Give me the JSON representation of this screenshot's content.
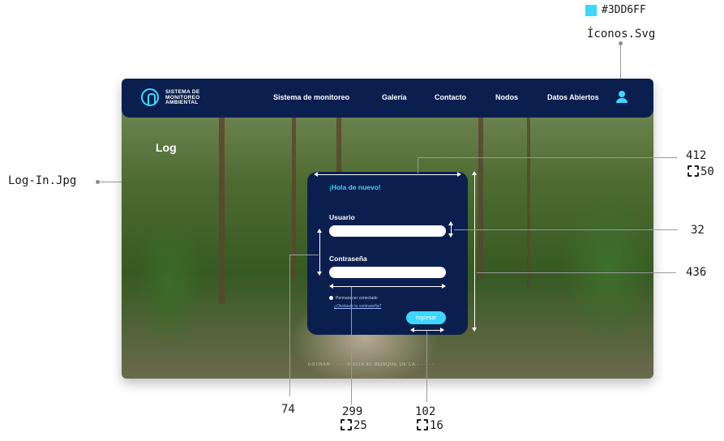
{
  "annotations": {
    "color_swatch": {
      "hex": "#3DD6FF",
      "label": "#3DD6FF"
    },
    "icons_file": "Íconos.Svg",
    "bg_file": "Log-In.Jpg",
    "dims": {
      "card_width": "412",
      "card_radius": "50",
      "input_height": "32",
      "card_height": "436",
      "label_spacing": "74",
      "input_width": "299",
      "input_radius": "25",
      "button_width": "102",
      "button_radius": "16"
    }
  },
  "navbar": {
    "logo_lines": [
      "SISTEMA DE",
      "MONITOREO",
      "AMBIENTAL"
    ],
    "items": [
      "Sistema de monitoreo",
      "Galería",
      "Contacto",
      "Nodos",
      "Datos Abiertos"
    ]
  },
  "page": {
    "title": "Log"
  },
  "login": {
    "greeting": "¡Hola de nuevo!",
    "user_label": "Usuario",
    "user_value": "",
    "pass_label": "Contraseña",
    "pass_value": "",
    "remember": "Permanecer conectado",
    "forgot": "¿Olvidaste tu contraseña?",
    "submit": "Ingresar"
  },
  "footer_text": "ESTRAR · · · · VISITA EL BOSQUE DE LA · · · · ·"
}
